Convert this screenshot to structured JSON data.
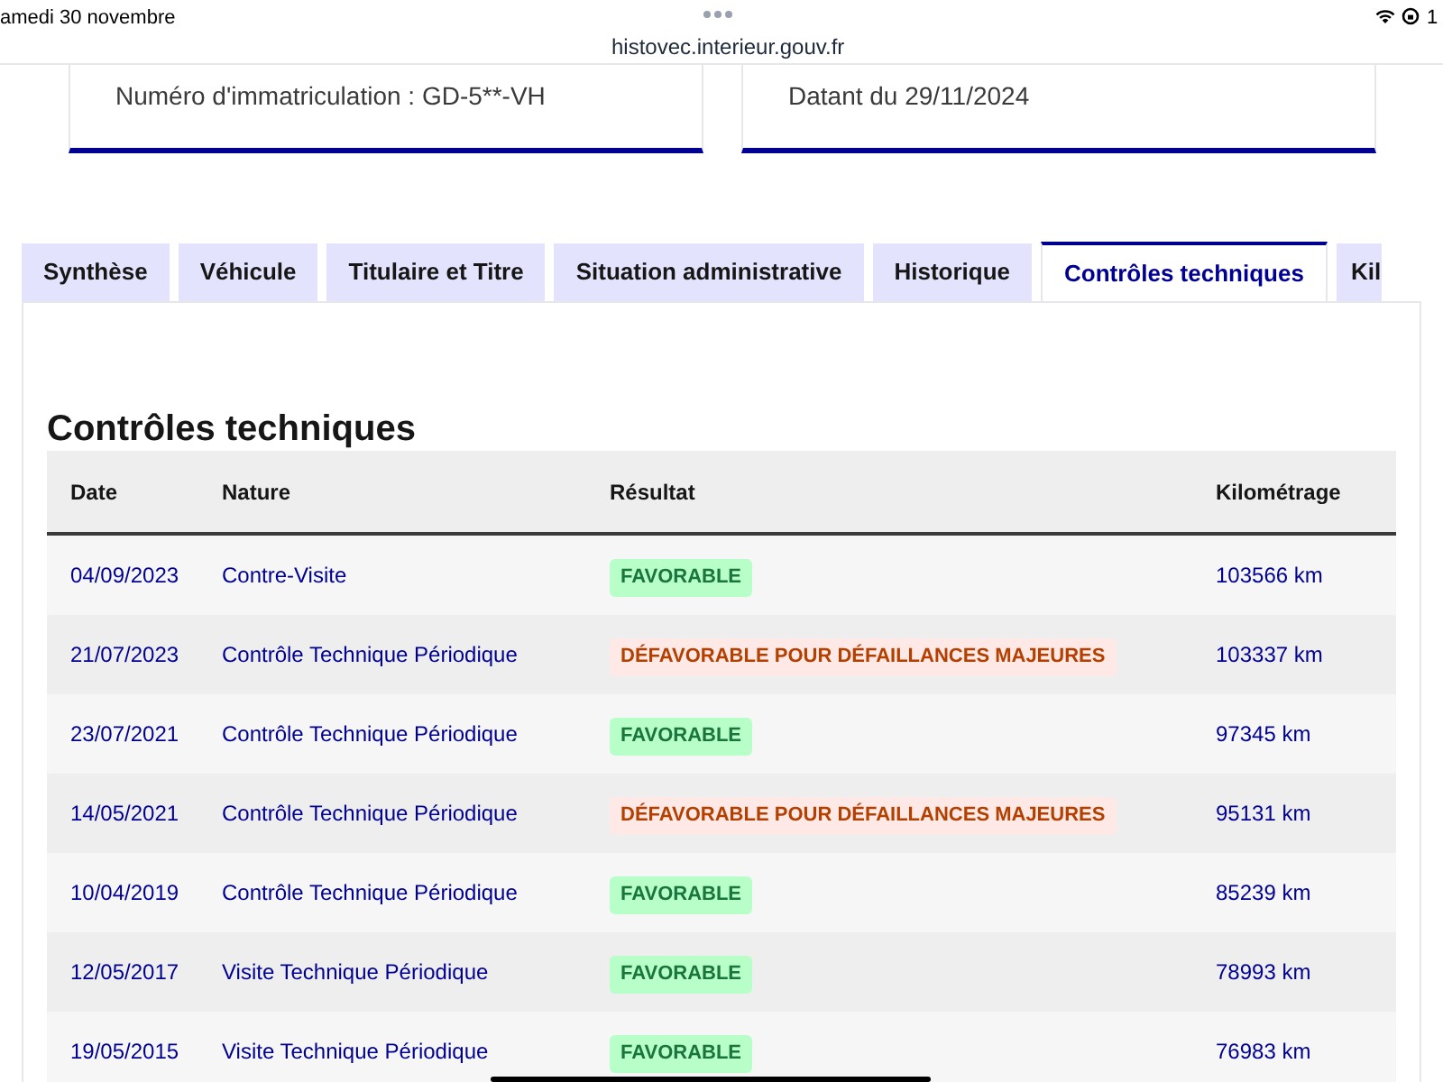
{
  "status_bar": {
    "date": "amedi 30 novembre",
    "battery": "1"
  },
  "address_bar": {
    "url": "histovec.interieur.gouv.fr"
  },
  "info_cards": [
    {
      "text": "Numéro d'immatriculation : GD-5**-VH"
    },
    {
      "text": "Datant du 29/11/2024"
    }
  ],
  "tabs": [
    {
      "label": "Synthèse",
      "selected": false
    },
    {
      "label": "Véhicule",
      "selected": false
    },
    {
      "label": "Titulaire et Titre",
      "selected": false
    },
    {
      "label": "Situation administrative",
      "selected": false
    },
    {
      "label": "Historique",
      "selected": false
    },
    {
      "label": "Contrôles techniques",
      "selected": true
    },
    {
      "label": "Kil",
      "selected": false
    }
  ],
  "section_title": "Contrôles techniques",
  "table": {
    "columns": [
      "Date",
      "Nature",
      "Résultat",
      "Kilométrage"
    ],
    "rows": [
      {
        "date": "04/09/2023",
        "nature": "Contre-Visite",
        "result": {
          "kind": "favorable",
          "text": "FAVORABLE"
        },
        "km": "103566 km"
      },
      {
        "date": "21/07/2023",
        "nature": "Contrôle Technique Périodique",
        "result": {
          "kind": "unfavorable",
          "text": "DÉFAVORABLE POUR DÉFAILLANCES MAJEURES"
        },
        "km": "103337 km"
      },
      {
        "date": "23/07/2021",
        "nature": "Contrôle Technique Périodique",
        "result": {
          "kind": "favorable",
          "text": "FAVORABLE"
        },
        "km": "97345 km"
      },
      {
        "date": "14/05/2021",
        "nature": "Contrôle Technique Périodique",
        "result": {
          "kind": "unfavorable",
          "text": "DÉFAVORABLE POUR DÉFAILLANCES MAJEURES"
        },
        "km": "95131 km"
      },
      {
        "date": "10/04/2019",
        "nature": "Contrôle Technique Périodique",
        "result": {
          "kind": "favorable",
          "text": "FAVORABLE"
        },
        "km": "85239 km"
      },
      {
        "date": "12/05/2017",
        "nature": "Visite Technique Périodique",
        "result": {
          "kind": "favorable",
          "text": "FAVORABLE"
        },
        "km": "78993 km"
      },
      {
        "date": "19/05/2015",
        "nature": "Visite Technique Périodique",
        "result": {
          "kind": "favorable",
          "text": "FAVORABLE"
        },
        "km": "76983 km"
      }
    ]
  }
}
